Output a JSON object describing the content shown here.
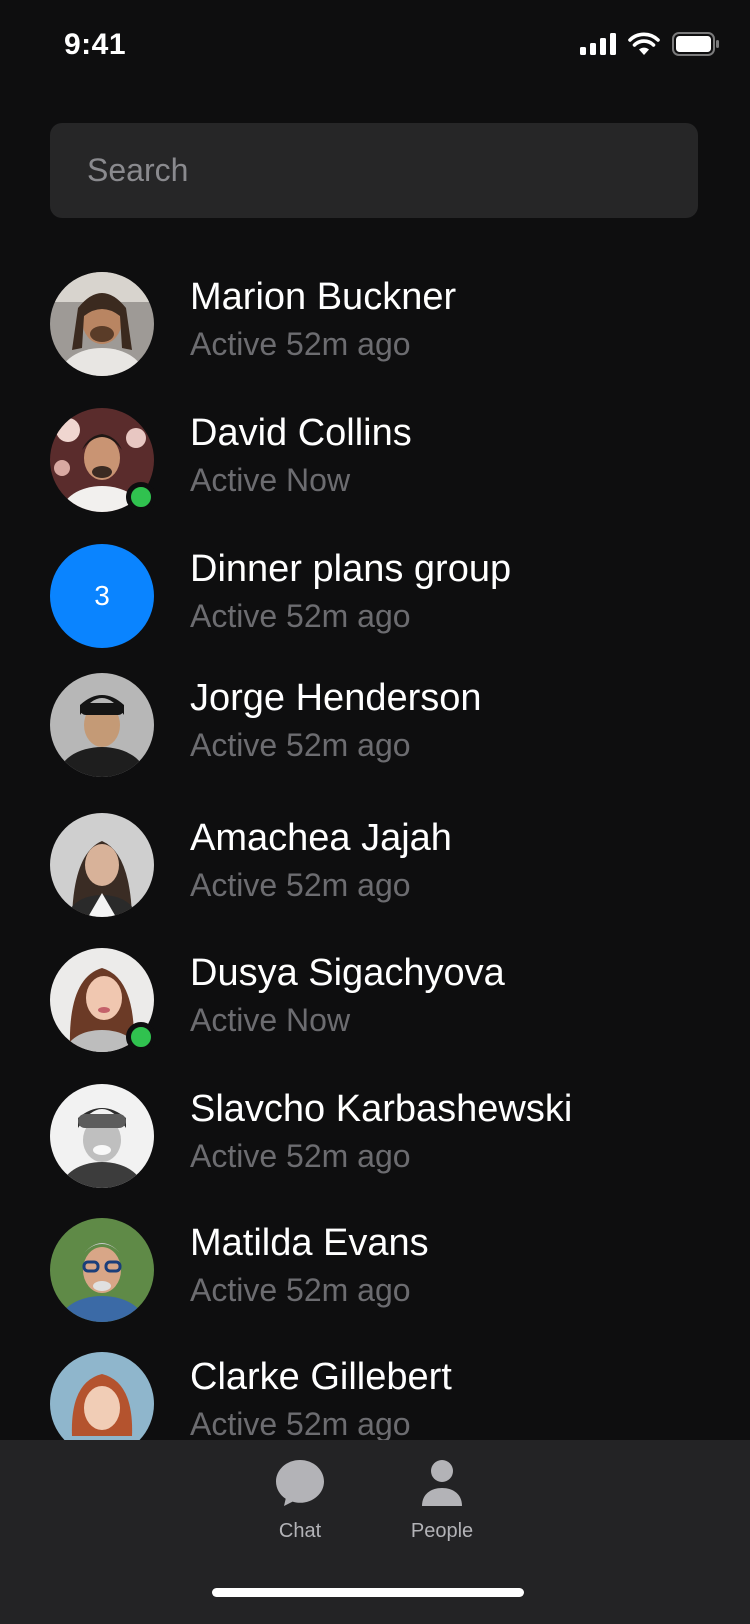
{
  "status_bar": {
    "time": "9:41"
  },
  "search": {
    "placeholder": "Search"
  },
  "contacts": [
    {
      "name": "Marion Buckner",
      "status": "Active 52m ago"
    },
    {
      "name": "David Collins",
      "status": "Active Now"
    },
    {
      "name": "Dinner plans group",
      "status": "Active 52m ago",
      "group_count": "3"
    },
    {
      "name": "Jorge Henderson",
      "status": "Active 52m ago"
    },
    {
      "name": "Amachea Jajah",
      "status": "Active 52m ago"
    },
    {
      "name": "Dusya Sigachyova",
      "status": "Active Now"
    },
    {
      "name": "Slavcho Karbashewski",
      "status": "Active 52m ago"
    },
    {
      "name": "Matilda Evans",
      "status": "Active 52m ago"
    },
    {
      "name": "Clarke Gillebert",
      "status": "Active 52m ago"
    }
  ],
  "tab_bar": {
    "tabs": [
      {
        "label": "Chat",
        "icon": "chat-bubble-icon"
      },
      {
        "label": "People",
        "icon": "person-icon"
      }
    ]
  },
  "colors": {
    "background": "#0e0e0f",
    "search_bg": "#262627",
    "online": "#30c24f",
    "group_avatar": "#0a84ff",
    "secondary_text": "#6c6c70",
    "tab_bar_bg": "#232325"
  }
}
